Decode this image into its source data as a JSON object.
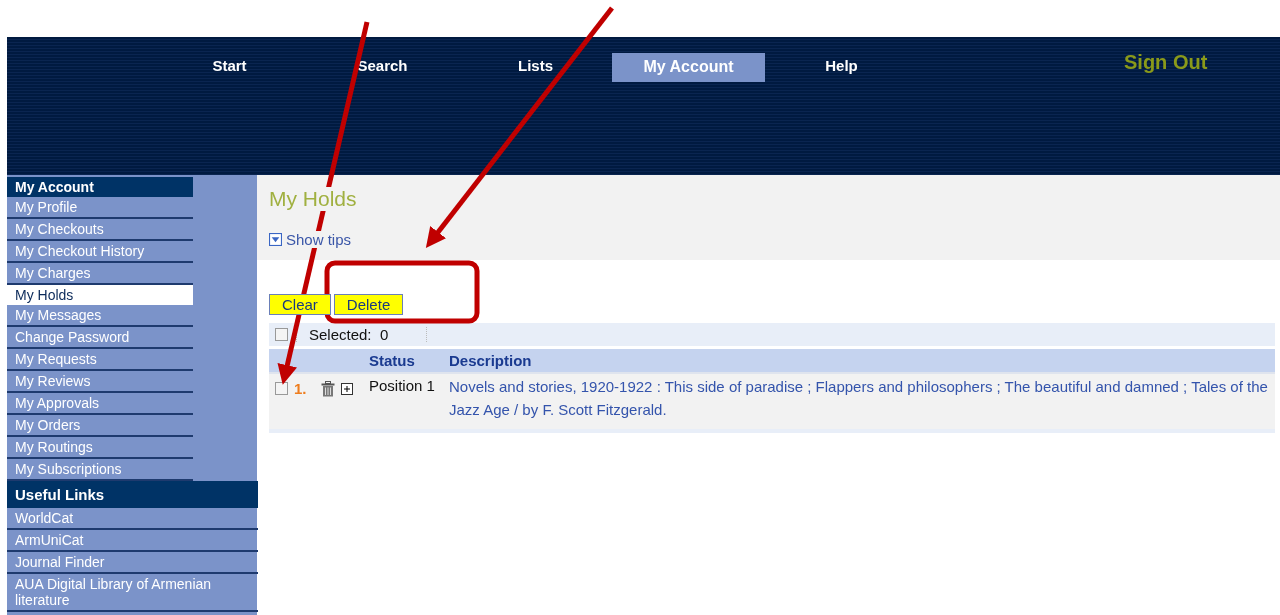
{
  "nav": {
    "items": [
      {
        "label": "Start",
        "selected": false
      },
      {
        "label": "Search",
        "selected": false
      },
      {
        "label": "Lists",
        "selected": false
      },
      {
        "label": "My Account",
        "selected": true
      },
      {
        "label": "Help",
        "selected": false
      }
    ],
    "sign_out": "Sign Out"
  },
  "sidebar": {
    "sections": [
      {
        "title": "My Account",
        "wide": false,
        "items": [
          {
            "label": "My Profile",
            "selected": false
          },
          {
            "label": "My Checkouts",
            "selected": false
          },
          {
            "label": "My Checkout History",
            "selected": false
          },
          {
            "label": "My Charges",
            "selected": false
          },
          {
            "label": "My Holds",
            "selected": true
          },
          {
            "label": "My Messages",
            "selected": false
          },
          {
            "label": "Change Password",
            "selected": false
          },
          {
            "label": "My Requests",
            "selected": false
          },
          {
            "label": "My Reviews",
            "selected": false
          },
          {
            "label": "My Approvals",
            "selected": false
          },
          {
            "label": "My Orders",
            "selected": false
          },
          {
            "label": "My Routings",
            "selected": false
          },
          {
            "label": "My Subscriptions",
            "selected": false
          }
        ]
      },
      {
        "title": "Useful Links",
        "wide": true,
        "items": [
          {
            "label": "WorldCat",
            "selected": false
          },
          {
            "label": "ArmUniCat",
            "selected": false
          },
          {
            "label": "Journal Finder",
            "selected": false
          },
          {
            "label": "AUA Digital Library of Armenian literature",
            "selected": false
          }
        ]
      }
    ]
  },
  "content": {
    "title": "My Holds",
    "tips_toggle": "Show tips",
    "buttons": [
      "Clear",
      "Delete"
    ],
    "selection": {
      "checked": false,
      "label": "Selected:",
      "count": "0"
    },
    "table": {
      "columns": [
        "Status",
        "Description"
      ],
      "rows": [
        {
          "checked": false,
          "number": "1.",
          "status": "Position 1",
          "description": "Novels and stories, 1920-1922 : This side of paradise ; Flappers and philosophers ; The beautiful and damned ; Tales of the Jazz Age / by F. Scott Fitzgerald."
        }
      ]
    }
  }
}
